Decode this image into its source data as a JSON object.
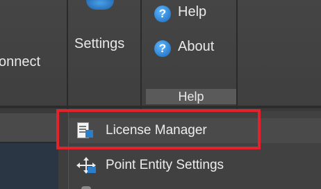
{
  "ribbon": {
    "connect_label": "onnect",
    "settings_label": "Settings",
    "help_label": "Help",
    "about_label": "About",
    "group_label": "Help"
  },
  "menu": {
    "items": [
      {
        "label": "License Manager",
        "icon": "license-document-icon",
        "highlighted": true
      },
      {
        "label": "Point Entity Settings",
        "icon": "point-entity-move-icon",
        "highlighted": false
      }
    ]
  },
  "colors": {
    "highlight_border": "#e3232c",
    "ribbon_bg": "#434343",
    "menu_bg": "#414141",
    "icon_blue": "#1a67b8"
  }
}
